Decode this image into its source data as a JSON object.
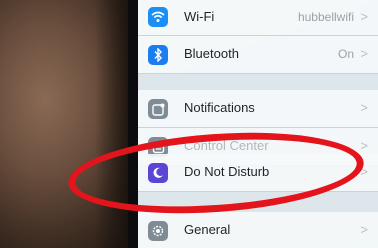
{
  "settings": {
    "wifi": {
      "label": "Wi-Fi",
      "value": "hubbellwifi",
      "chevron": ">"
    },
    "bluetooth": {
      "label": "Bluetooth",
      "value": "On",
      "chevron": ">"
    },
    "notifications": {
      "label": "Notifications",
      "chevron": ">"
    },
    "control_center": {
      "label": "Control Center",
      "chevron": ">"
    },
    "do_not_disturb": {
      "label": "Do Not Disturb",
      "chevron": ">"
    },
    "general": {
      "label": "General",
      "chevron": ">"
    }
  },
  "annotation": {
    "color": "#e3141b"
  },
  "colors": {
    "wifi_icon": "#1a8ff5",
    "bluetooth_icon": "#1a7df0",
    "notifications_icon": "#7f8c95",
    "control_center_icon": "#7f8c95",
    "dnd_icon": "#5b45d6",
    "general_icon": "#7f8c95"
  }
}
